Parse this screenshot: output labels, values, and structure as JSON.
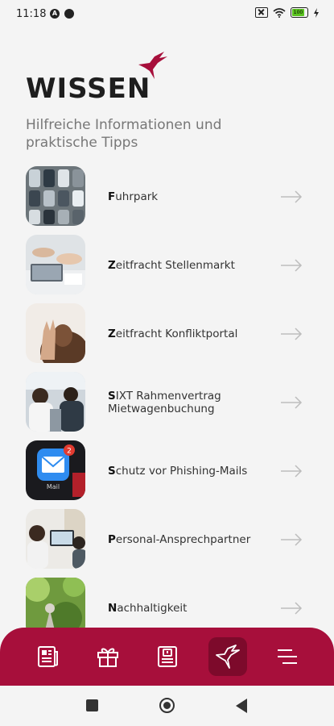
{
  "status_bar": {
    "time": "11:18",
    "battery": "100",
    "icons": [
      "a-badge-icon",
      "blocked-icon",
      "no-sim-icon",
      "wifi-icon",
      "battery-icon",
      "charging-icon"
    ]
  },
  "header": {
    "title": "WISSEN",
    "subtitle": "Hilfreiche Informationen und praktische Tipps",
    "logo_icon": "hummingbird-icon"
  },
  "list": {
    "items": [
      {
        "first": "F",
        "rest": "uhrpark"
      },
      {
        "first": "Z",
        "rest": "eitfracht Stellenmarkt"
      },
      {
        "first": "Z",
        "rest": "eitfracht Konfliktportal"
      },
      {
        "first": "S",
        "rest": "IXT Rahmenvertrag Mietwagenbuchung"
      },
      {
        "first": "S",
        "rest": "chutz vor Phishing-Mails"
      },
      {
        "first": "P",
        "rest": "ersonal-Ansprechpartner"
      },
      {
        "first": "N",
        "rest": "achhaltigkeit"
      }
    ],
    "mail_badge": "2",
    "mail_app_label": "Mail"
  },
  "bottom_nav": {
    "items": [
      "news-icon",
      "gift-icon",
      "document-icon",
      "hummingbird-icon",
      "menu-icon"
    ],
    "active_index": 3
  },
  "colors": {
    "brand": "#a70f3b",
    "brand_dark": "#7d0a2b",
    "background": "#f4f4f4"
  }
}
